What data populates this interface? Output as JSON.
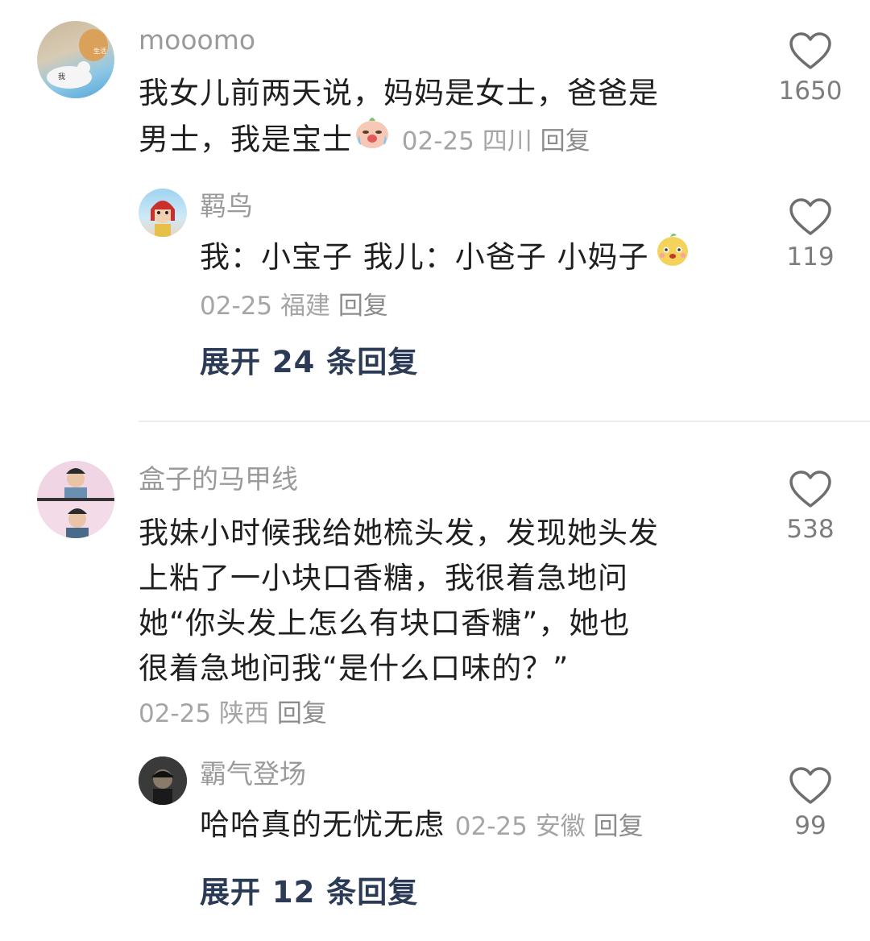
{
  "comments": [
    {
      "username": "mooomo",
      "text": "我女儿前两天说，妈妈是女士，爸爸是男士，我是宝士",
      "text_line1": "我女儿前两天说，妈妈是女士，爸爸是",
      "text_line2": "男士，我是宝士",
      "emoji_icon": "crying-laughing-face-icon",
      "date": "02-25",
      "location": "四川",
      "reply_label": "回复",
      "likes": "1650",
      "avatar_badge": "生活",
      "avatar_label": "我",
      "replies": [
        {
          "username": "羁鸟",
          "text": "我：小宝子 我儿：小爸子 小妈子",
          "emoji_icon": "cute-face-icon",
          "date": "02-25",
          "location": "福建",
          "reply_label": "回复",
          "likes": "119"
        }
      ],
      "expand_label": "展开 24 条回复"
    },
    {
      "username": "盒子的马甲线",
      "text_lines": [
        "我妹小时候我给她梳头发，发现她头发",
        "上粘了一小块口香糖，我很着急地问",
        "她“你头发上怎么有块口香糖”，她也",
        "很着急地问我“是什么口味的？”"
      ],
      "date": "02-25",
      "location": "陕西",
      "reply_label": "回复",
      "likes": "538",
      "replies": [
        {
          "username": "霸气登场",
          "text": "哈哈真的无忧无虑",
          "date": "02-25",
          "location": "安徽",
          "reply_label": "回复",
          "likes": "99"
        }
      ],
      "expand_label": "展开 12 条回复"
    }
  ],
  "colors": {
    "text": "#1f1f1f",
    "username": "#9a9a9a",
    "meta": "#a5a5a5",
    "expand": "#2b3a55",
    "heart": "#6e6e6e"
  }
}
